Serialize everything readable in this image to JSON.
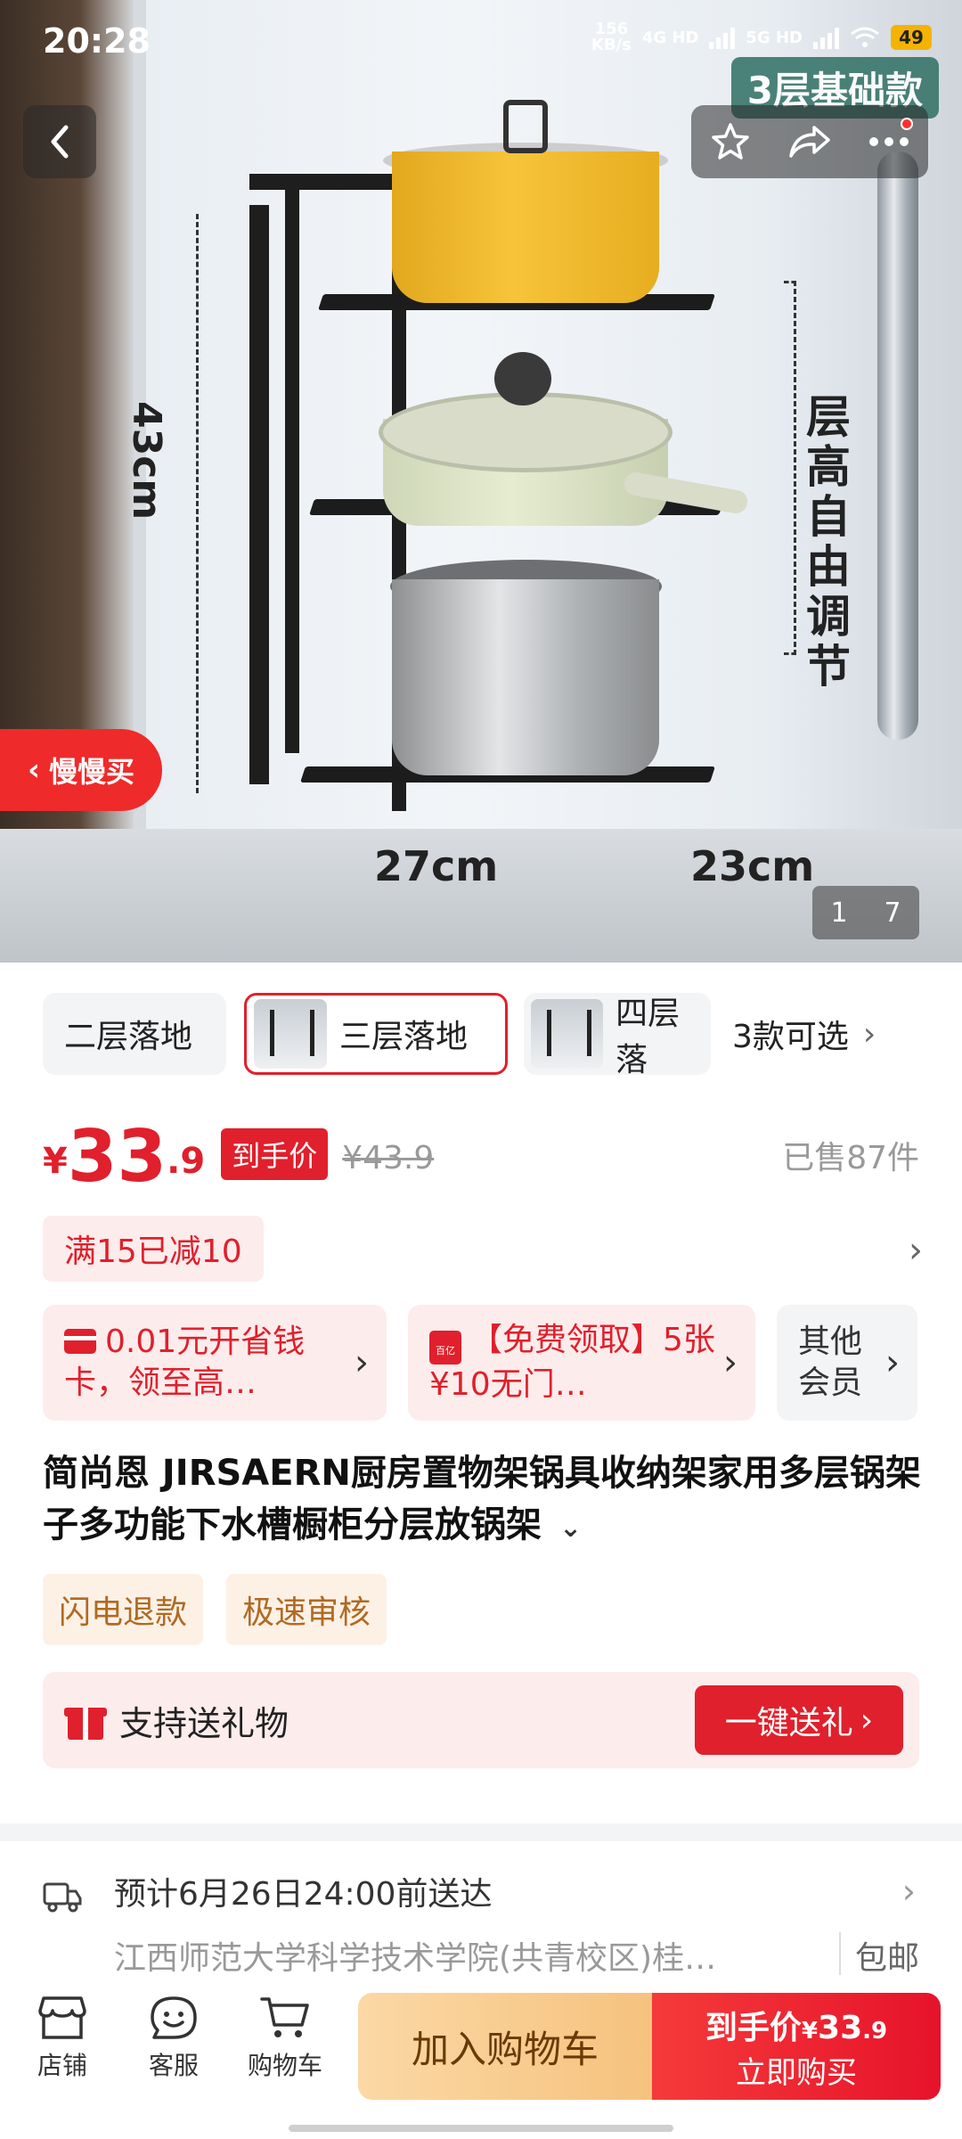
{
  "status_bar": {
    "time": "20:28",
    "net_speed_value": "156",
    "net_speed_unit": "KB/s",
    "signal1": "4G HD",
    "signal2": "5G HD",
    "battery": "49"
  },
  "hero": {
    "badge": "3层基础款",
    "dim_height": "43cm",
    "dim_width": "27cm",
    "dim_depth": "23cm",
    "layer_note": "层高自由调节",
    "slow_buy_label": "慢慢买",
    "pager_current": "1",
    "pager_total": "7"
  },
  "icons": {
    "back": "back-arrow-icon",
    "star": "star-icon",
    "share": "share-icon",
    "more": "more-icon",
    "store": "store-icon",
    "service": "service-icon",
    "cart": "cart-icon",
    "truck": "truck-icon",
    "gift": "gift-icon"
  },
  "variants": {
    "items": [
      {
        "label": "二层落地"
      },
      {
        "label": "三层落地"
      },
      {
        "label": "四层落"
      }
    ],
    "more_label": "3款可选"
  },
  "price": {
    "currency": "¥",
    "integer": "33",
    "decimal": ".9",
    "tag": "到手价",
    "original": "¥43.9",
    "sold": "已售87件"
  },
  "promo": {
    "text": "满15已减10"
  },
  "coupons": [
    {
      "text": "0.01元开省钱卡，领至高…"
    },
    {
      "badge": "百亿",
      "text": "【免费领取】5张¥10无门…"
    },
    {
      "text": "其他会员"
    }
  ],
  "product": {
    "title": "简尚恩 JIRSAERN厨房置物架锅具收纳架家用多层锅架子多功能下水槽橱柜分层放锅架"
  },
  "tags": [
    "闪电退款",
    "极速审核"
  ],
  "gift": {
    "text": "支持送礼物",
    "button": "一键送礼"
  },
  "delivery": {
    "eta": "预计6月26日24:00前送达",
    "address": "江西师范大学科学技术学院(共青校区)桂…",
    "shipping": "包邮"
  },
  "bottom_bar": {
    "store": "店铺",
    "service": "客服",
    "cart": "购物车",
    "add_to_cart": "加入购物车",
    "buy_line1_prefix": "到手价",
    "buy_line1_currency": "¥",
    "buy_line1_int": "33",
    "buy_line1_dec": ".9",
    "buy_line2": "立即购买"
  },
  "colors": {
    "accent_red": "#e0202c",
    "cart_orange": "#f6c27e",
    "promo_bg": "#fdecec"
  }
}
